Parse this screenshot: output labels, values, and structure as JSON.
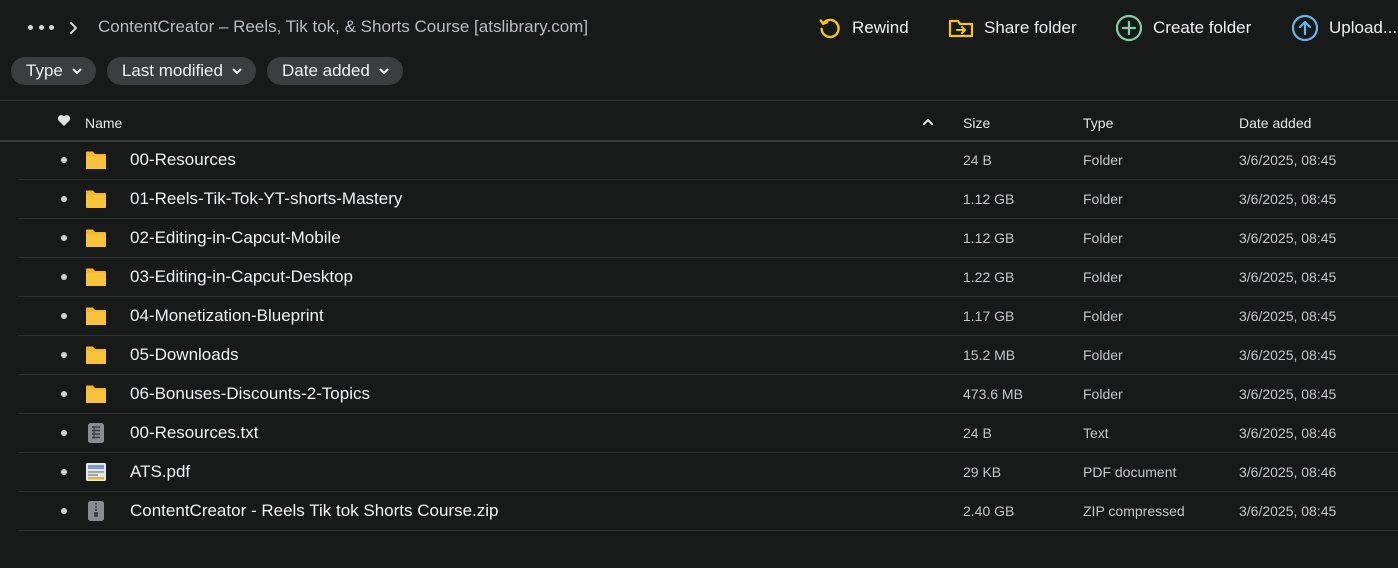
{
  "breadcrumb": {
    "title": "ContentCreator – Reels, Tik tok, & Shorts Course [atslibrary.com]"
  },
  "actions": {
    "rewind": "Rewind",
    "share_folder": "Share folder",
    "create_folder": "Create folder",
    "upload": "Upload..."
  },
  "filters": {
    "type": "Type",
    "last_modified": "Last modified",
    "date_added": "Date added"
  },
  "columns": {
    "name": "Name",
    "size": "Size",
    "type": "Type",
    "date_added": "Date added"
  },
  "colors": {
    "background": "#181919",
    "rewind_icon": "#f5c51b",
    "share_icon": "#f5c51b",
    "create_icon": "#7fd0ad",
    "upload_icon": "#6cb3f0",
    "folder": "#f6b72e"
  },
  "files": [
    {
      "name": "00-Resources",
      "size": "24 B",
      "type": "Folder",
      "date": "3/6/2025, 08:45",
      "icon": "folder-icon"
    },
    {
      "name": "01-Reels-Tik-Tok-YT-shorts-Mastery",
      "size": "1.12 GB",
      "type": "Folder",
      "date": "3/6/2025, 08:45",
      "icon": "folder-icon"
    },
    {
      "name": "02-Editing-in-Capcut-Mobile",
      "size": "1.12 GB",
      "type": "Folder",
      "date": "3/6/2025, 08:45",
      "icon": "folder-icon"
    },
    {
      "name": "03-Editing-in-Capcut-Desktop",
      "size": "1.22 GB",
      "type": "Folder",
      "date": "3/6/2025, 08:45",
      "icon": "folder-icon"
    },
    {
      "name": "04-Monetization-Blueprint",
      "size": "1.17 GB",
      "type": "Folder",
      "date": "3/6/2025, 08:45",
      "icon": "folder-icon"
    },
    {
      "name": "05-Downloads",
      "size": "15.2 MB",
      "type": "Folder",
      "date": "3/6/2025, 08:45",
      "icon": "folder-icon"
    },
    {
      "name": "06-Bonuses-Discounts-2-Topics",
      "size": "473.6 MB",
      "type": "Folder",
      "date": "3/6/2025, 08:45",
      "icon": "folder-icon"
    },
    {
      "name": "00-Resources.txt",
      "size": "24 B",
      "type": "Text",
      "date": "3/6/2025, 08:46",
      "icon": "text-file-icon"
    },
    {
      "name": "ATS.pdf",
      "size": "29 KB",
      "type": "PDF document",
      "date": "3/6/2025, 08:46",
      "icon": "pdf-file-icon"
    },
    {
      "name": "ContentCreator - Reels Tik tok Shorts Course.zip",
      "size": "2.40 GB",
      "type": "ZIP compressed",
      "date": "3/6/2025, 08:45",
      "icon": "zip-file-icon"
    }
  ]
}
